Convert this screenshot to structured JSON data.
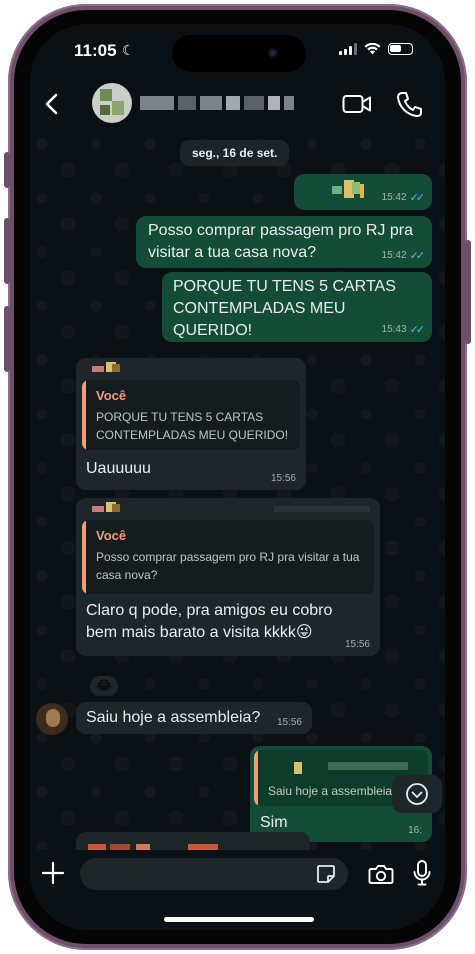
{
  "status_bar": {
    "time": "11:05",
    "moon_icon": "moon-icon"
  },
  "header": {
    "back_icon": "chevron-left-icon",
    "video_icon": "video-camera-icon",
    "call_icon": "phone-icon"
  },
  "chat": {
    "date_label": "seg., 16 de set.",
    "messages": [
      {
        "direction": "outgoing",
        "kind": "sticker",
        "time": "15:42",
        "status": "read"
      },
      {
        "direction": "outgoing",
        "text": "Posso comprar passagem pro RJ pra visitar a tua casa nova?",
        "time": "15:42",
        "status": "read"
      },
      {
        "direction": "outgoing",
        "text": "PORQUE TU TENS 5 CARTAS CONTEMPLADAS MEU QUERIDO!",
        "time": "15:43",
        "status": "read"
      },
      {
        "direction": "incoming",
        "quote_author": "Você",
        "quote_text": "PORQUE TU TENS 5 CARTAS CONTEMPLADAS MEU QUERIDO!",
        "text": "Uauuuuu",
        "time": "15:56"
      },
      {
        "direction": "incoming",
        "quote_author": "Você",
        "quote_text": "Posso comprar passagem pro RJ pra visitar a tua casa nova?",
        "text": "Claro q pode, pra amigos eu cobro bem mais barato a visita kkkk😜",
        "time": "15:56",
        "reaction": "😂"
      },
      {
        "direction": "incoming",
        "text": "Saiu hoje a assembleia?",
        "time": "15:56"
      },
      {
        "direction": "outgoing",
        "quote_text": "Saiu hoje a assembleia?",
        "text": "Sim",
        "time": "16:"
      }
    ]
  },
  "input_bar": {
    "placeholder": "",
    "icons": [
      "plus-icon",
      "sticker-icon",
      "camera-icon",
      "microphone-icon"
    ]
  },
  "colors": {
    "outgoing_bubble": "#144d37",
    "incoming_bubble": "#1f2629",
    "read_ticks": "#53bdeb",
    "quote_accent": "#f29c7c",
    "frame": "#6e4f6a"
  }
}
